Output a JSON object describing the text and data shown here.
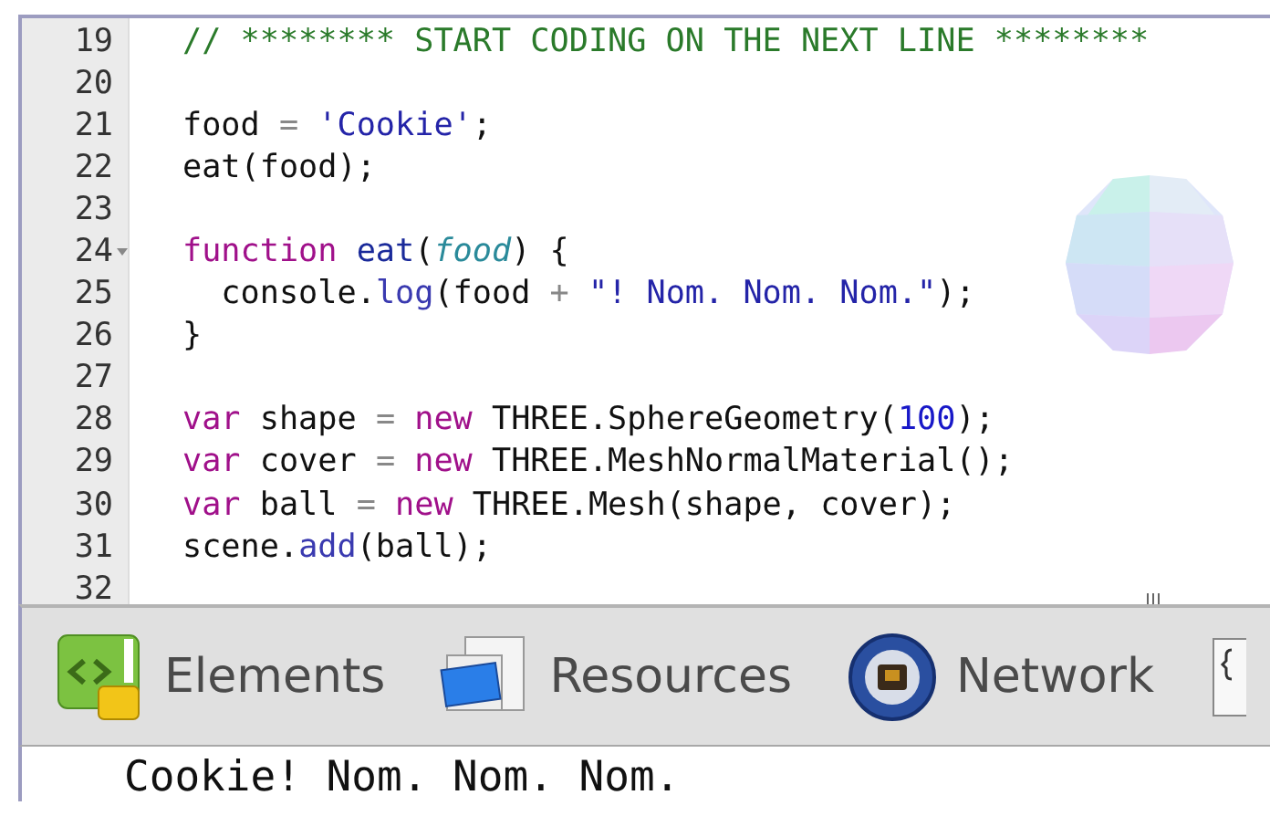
{
  "editor": {
    "lines": [
      {
        "number": "19",
        "foldable": false,
        "tokens": [
          {
            "kind": "comment",
            "text": "// ******** START CODING ON THE NEXT LINE ********"
          }
        ]
      },
      {
        "number": "20",
        "foldable": false
      },
      {
        "number": "21",
        "foldable": false,
        "tokens": [
          {
            "kind": "plain",
            "text": "food "
          },
          {
            "kind": "operator",
            "text": "= "
          },
          {
            "kind": "string",
            "text": "'Cookie'"
          },
          {
            "kind": "plain",
            "text": ";"
          }
        ]
      },
      {
        "number": "22",
        "foldable": false,
        "tokens": [
          {
            "kind": "plain",
            "text": "eat(food);"
          }
        ]
      },
      {
        "number": "23",
        "foldable": false
      },
      {
        "number": "24",
        "foldable": true,
        "tokens": [
          {
            "kind": "keyword",
            "text": "function "
          },
          {
            "kind": "def",
            "text": "eat"
          },
          {
            "kind": "plain",
            "text": "("
          },
          {
            "kind": "param",
            "text": "food"
          },
          {
            "kind": "plain",
            "text": ") {"
          }
        ]
      },
      {
        "number": "25",
        "foldable": false,
        "tokens": [
          {
            "kind": "plain",
            "text": "  console."
          },
          {
            "kind": "property",
            "text": "log"
          },
          {
            "kind": "plain",
            "text": "(food "
          },
          {
            "kind": "operator",
            "text": "+ "
          },
          {
            "kind": "string",
            "text": "\"! Nom. Nom. Nom.\""
          },
          {
            "kind": "plain",
            "text": ");"
          }
        ]
      },
      {
        "number": "26",
        "foldable": false,
        "tokens": [
          {
            "kind": "plain",
            "text": "}"
          }
        ]
      },
      {
        "number": "27",
        "foldable": false
      },
      {
        "number": "28",
        "foldable": false,
        "tokens": [
          {
            "kind": "keyword",
            "text": "var"
          },
          {
            "kind": "plain",
            "text": " shape "
          },
          {
            "kind": "operator",
            "text": "= "
          },
          {
            "kind": "keyword",
            "text": "new"
          },
          {
            "kind": "plain",
            "text": " THREE.SphereGeometry("
          },
          {
            "kind": "number",
            "text": "100"
          },
          {
            "kind": "plain",
            "text": ");"
          }
        ]
      },
      {
        "number": "29",
        "foldable": false,
        "tokens": [
          {
            "kind": "keyword",
            "text": "var"
          },
          {
            "kind": "plain",
            "text": " cover "
          },
          {
            "kind": "operator",
            "text": "= "
          },
          {
            "kind": "keyword",
            "text": "new"
          },
          {
            "kind": "plain",
            "text": " THREE.MeshNormalMaterial();"
          }
        ]
      },
      {
        "number": "30",
        "foldable": false,
        "tokens": [
          {
            "kind": "keyword",
            "text": "var"
          },
          {
            "kind": "plain",
            "text": " ball "
          },
          {
            "kind": "operator",
            "text": "= "
          },
          {
            "kind": "keyword",
            "text": "new"
          },
          {
            "kind": "plain",
            "text": " THREE.Mesh(shape, cover);"
          }
        ]
      },
      {
        "number": "31",
        "foldable": false,
        "tokens": [
          {
            "kind": "plain",
            "text": "scene."
          },
          {
            "kind": "property",
            "text": "add"
          },
          {
            "kind": "plain",
            "text": "(ball);"
          }
        ]
      },
      {
        "number": "32",
        "foldable": false
      }
    ]
  },
  "devtools": {
    "tabs": [
      {
        "kind": "elements",
        "label": "Elements"
      },
      {
        "kind": "resources",
        "label": "Resources"
      },
      {
        "kind": "network",
        "label": "Network"
      },
      {
        "kind": "sources"
      }
    ]
  },
  "console": {
    "output": "Cookie! Nom. Nom. Nom."
  }
}
